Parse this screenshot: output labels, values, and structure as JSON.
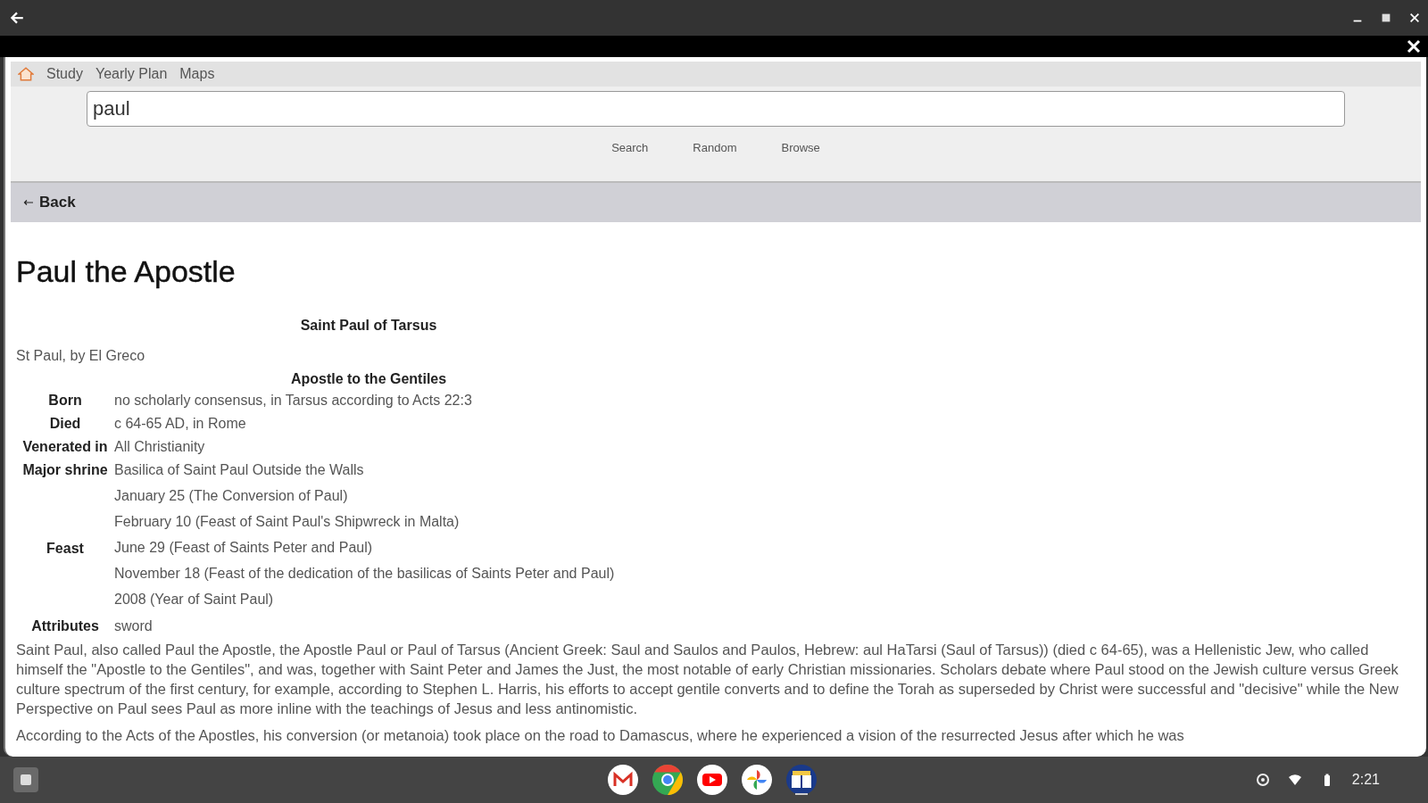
{
  "menu": {
    "items": [
      "Study",
      "Yearly Plan",
      "Maps"
    ]
  },
  "search": {
    "value": "paul"
  },
  "actions": [
    "Search",
    "Random",
    "Browse"
  ],
  "back": {
    "label": "Back"
  },
  "article": {
    "title": "Paul the Apostle",
    "infobox": {
      "name": "Saint Paul of Tarsus",
      "caption": "St Paul, by El Greco",
      "subtitle": "Apostle to the Gentiles",
      "rows": [
        {
          "label": "Born",
          "values": [
            "no scholarly consensus, in Tarsus according to Acts 22:3"
          ]
        },
        {
          "label": "Died",
          "values": [
            "c 64-65 AD, in Rome"
          ]
        },
        {
          "label": "Venerated in",
          "values": [
            "All Christianity"
          ]
        },
        {
          "label": "Major shrine",
          "values": [
            "Basilica of Saint Paul Outside the Walls"
          ]
        },
        {
          "label": "Feast",
          "values": [
            "January 25 (The Conversion of Paul)",
            "February 10 (Feast of Saint Paul's Shipwreck in Malta)",
            "June 29 (Feast of Saints Peter and Paul)",
            "November 18 (Feast of the dedication of the basilicas of Saints Peter and Paul)",
            "2008 (Year of Saint Paul)"
          ]
        },
        {
          "label": "Attributes",
          "values": [
            "sword"
          ]
        }
      ]
    },
    "paragraphs": [
      "Saint Paul, also called Paul the Apostle, the Apostle Paul or Paul of Tarsus (Ancient Greek: Saul and Saulos and Paulos, Hebrew: aul HaTarsi (Saul of Tarsus)) (died c 64-65), was a Hellenistic Jew, who called himself the \"Apostle to the Gentiles\", and was, together with Saint Peter and James the Just, the most notable of early Christian missionaries. Scholars debate where Paul stood on the Jewish culture versus Greek culture spectrum of the first century, for example, according to Stephen L. Harris, his efforts to accept gentile converts and to define the Torah as superseded by Christ were successful and \"decisive\" while the New Perspective on Paul sees Paul as more inline with the teachings of Jesus and less antinomistic.",
      "According to the Acts of the Apostles, his conversion (or metanoia) took place on the road to Damascus, where he experienced a vision of the resurrected Jesus after which he was"
    ]
  },
  "shelf": {
    "apps": [
      {
        "kind": "mail"
      },
      {
        "kind": "browser"
      },
      {
        "kind": "video"
      },
      {
        "kind": "photos"
      },
      {
        "kind": "book"
      }
    ],
    "time": "2:21"
  }
}
